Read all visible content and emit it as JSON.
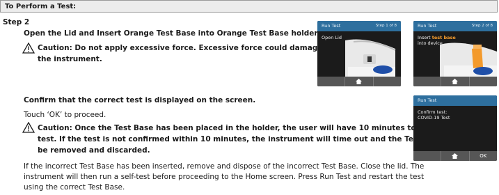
{
  "header": {
    "title": "To Perform a Test:"
  },
  "step": {
    "label": "Step 2"
  },
  "section1": {
    "instruction": "Open the Lid and Insert Orange Test Base into Orange Test Base holder",
    "caution_line1": "Caution: Do not apply excessive force. Excessive force could damage",
    "caution_line2": "the instrument."
  },
  "section2": {
    "heading": "Confirm that the correct test is displayed on the screen.",
    "touch_ok": "Touch ‘OK’ to proceed.",
    "caution_line1": "Caution: Once the Test Base has been placed in the holder, the user will have 10 minutes to confirm the",
    "caution_line2": "test. If the test is not confirmed within 10 minutes, the instrument will time out and the Test Base must",
    "caution_line3": "be removed and discarded.",
    "para_line1": "If the incorrect Test Base has been inserted, remove and dispose of the incorrect Test Base. Close the lid. The",
    "para_line2": "instrument will then run a self-test before proceeding to the Home screen. Press Run Test and restart the test",
    "para_line3": "using the correct Test Base."
  },
  "screens": {
    "open_lid": {
      "title": "Run Test",
      "step": "Step 1 of 8",
      "message": "Open Lid"
    },
    "insert_base": {
      "title": "Run Test",
      "step": "Step 2 of 8",
      "msg_a": "Insert ",
      "msg_hl": "test base",
      "msg_b": "into device."
    },
    "confirm": {
      "title": "Run Test",
      "line1": "Confirm test:",
      "line2": "COVID-19 Test",
      "ok": "OK"
    }
  },
  "colors": {
    "screen_bg": "#1b1b1b",
    "title_bar": "#2e6f9e",
    "footer": "#565656",
    "orange": "#f39a2c",
    "blue": "#1f4fa8"
  },
  "icons": {
    "home": "home-icon",
    "warning": "warning-triangle-icon"
  }
}
